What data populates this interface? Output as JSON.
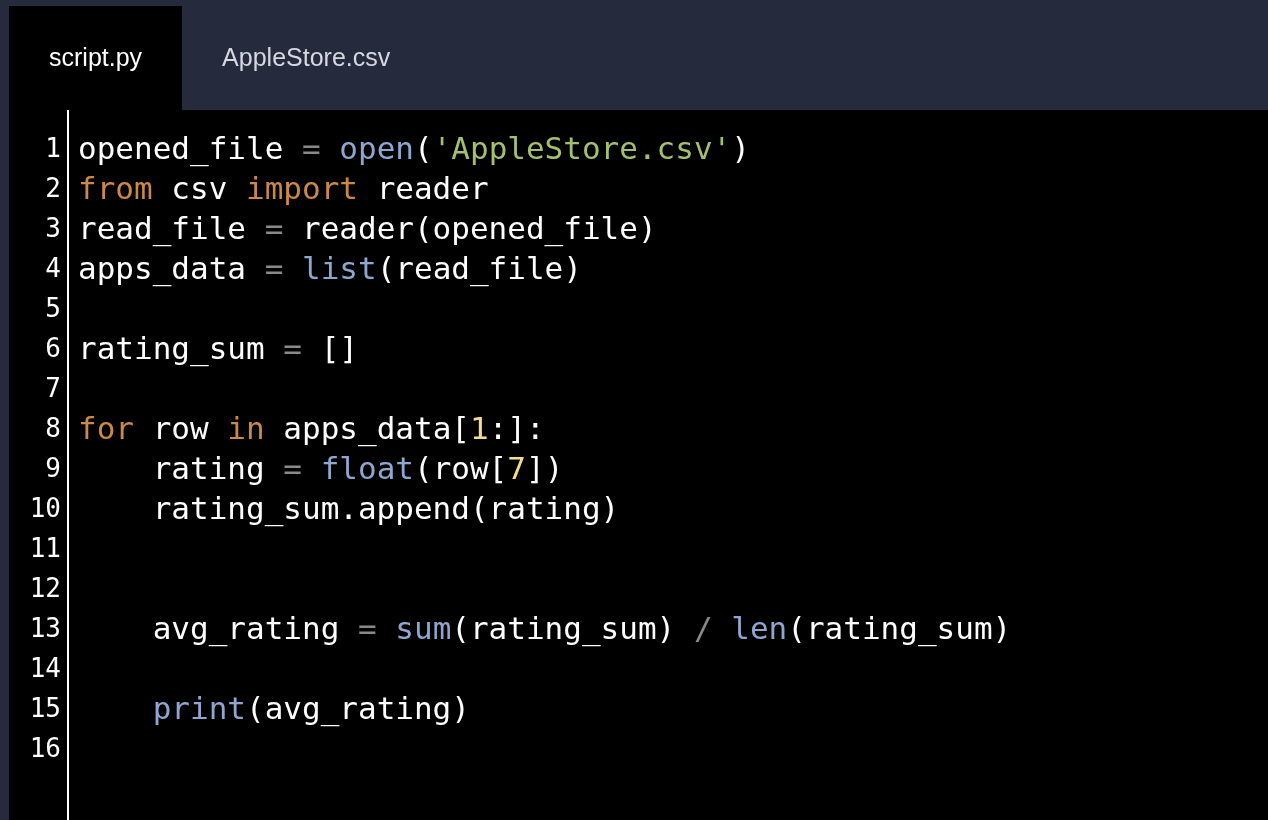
{
  "tabs": [
    {
      "label": "script.py",
      "selected": true
    },
    {
      "label": "AppleStore.csv",
      "selected": false
    }
  ],
  "editor": {
    "lines": [
      {
        "number": "1",
        "tokens": [
          {
            "kind": "plain",
            "text": "opened_file "
          },
          {
            "kind": "operator",
            "text": "="
          },
          {
            "kind": "builtin",
            "text": " open"
          },
          {
            "kind": "plain",
            "text": "("
          },
          {
            "kind": "string",
            "text": "'AppleStore.csv'"
          },
          {
            "kind": "plain",
            "text": ")"
          }
        ]
      },
      {
        "number": "2",
        "tokens": [
          {
            "kind": "keyword",
            "text": "from"
          },
          {
            "kind": "plain",
            "text": " csv "
          },
          {
            "kind": "keyword",
            "text": "import"
          },
          {
            "kind": "plain",
            "text": " reader"
          }
        ]
      },
      {
        "number": "3",
        "tokens": [
          {
            "kind": "plain",
            "text": "read_file "
          },
          {
            "kind": "operator",
            "text": "="
          },
          {
            "kind": "plain",
            "text": " reader(opened_file)"
          }
        ]
      },
      {
        "number": "4",
        "tokens": [
          {
            "kind": "plain",
            "text": "apps_data "
          },
          {
            "kind": "operator",
            "text": "="
          },
          {
            "kind": "builtin",
            "text": " list"
          },
          {
            "kind": "plain",
            "text": "(read_file)"
          }
        ]
      },
      {
        "number": "5"
      },
      {
        "number": "6",
        "tokens": [
          {
            "kind": "plain",
            "text": "rating_sum "
          },
          {
            "kind": "operator",
            "text": "="
          },
          {
            "kind": "plain",
            "text": " []"
          }
        ]
      },
      {
        "number": "7"
      },
      {
        "number": "8",
        "tokens": [
          {
            "kind": "keyword",
            "text": "for"
          },
          {
            "kind": "plain",
            "text": " row "
          },
          {
            "kind": "keyword",
            "text": "in"
          },
          {
            "kind": "plain",
            "text": " apps_data["
          },
          {
            "kind": "number",
            "text": "1"
          },
          {
            "kind": "plain",
            "text": ":]:"
          }
        ]
      },
      {
        "number": "9",
        "tokens": [
          {
            "kind": "plain",
            "text": "    rating "
          },
          {
            "kind": "operator",
            "text": "="
          },
          {
            "kind": "builtin",
            "text": " float"
          },
          {
            "kind": "plain",
            "text": "(row["
          },
          {
            "kind": "number",
            "text": "7"
          },
          {
            "kind": "plain",
            "text": "])"
          }
        ]
      },
      {
        "number": "10",
        "tokens": [
          {
            "kind": "plain",
            "text": "    rating_sum.append(rating)"
          }
        ]
      },
      {
        "number": "11"
      },
      {
        "number": "12"
      },
      {
        "number": "13",
        "tokens": [
          {
            "kind": "plain",
            "text": "    avg_rating "
          },
          {
            "kind": "operator",
            "text": "="
          },
          {
            "kind": "builtin",
            "text": " sum"
          },
          {
            "kind": "plain",
            "text": "(rating_sum) "
          },
          {
            "kind": "operator",
            "text": "/"
          },
          {
            "kind": "builtin",
            "text": " len"
          },
          {
            "kind": "plain",
            "text": "(rating_sum)"
          }
        ]
      },
      {
        "number": "14"
      },
      {
        "number": "15",
        "tokens": [
          {
            "kind": "builtin",
            "text": "    print"
          },
          {
            "kind": "plain",
            "text": "(avg_rating)"
          }
        ]
      },
      {
        "number": "16"
      }
    ]
  }
}
